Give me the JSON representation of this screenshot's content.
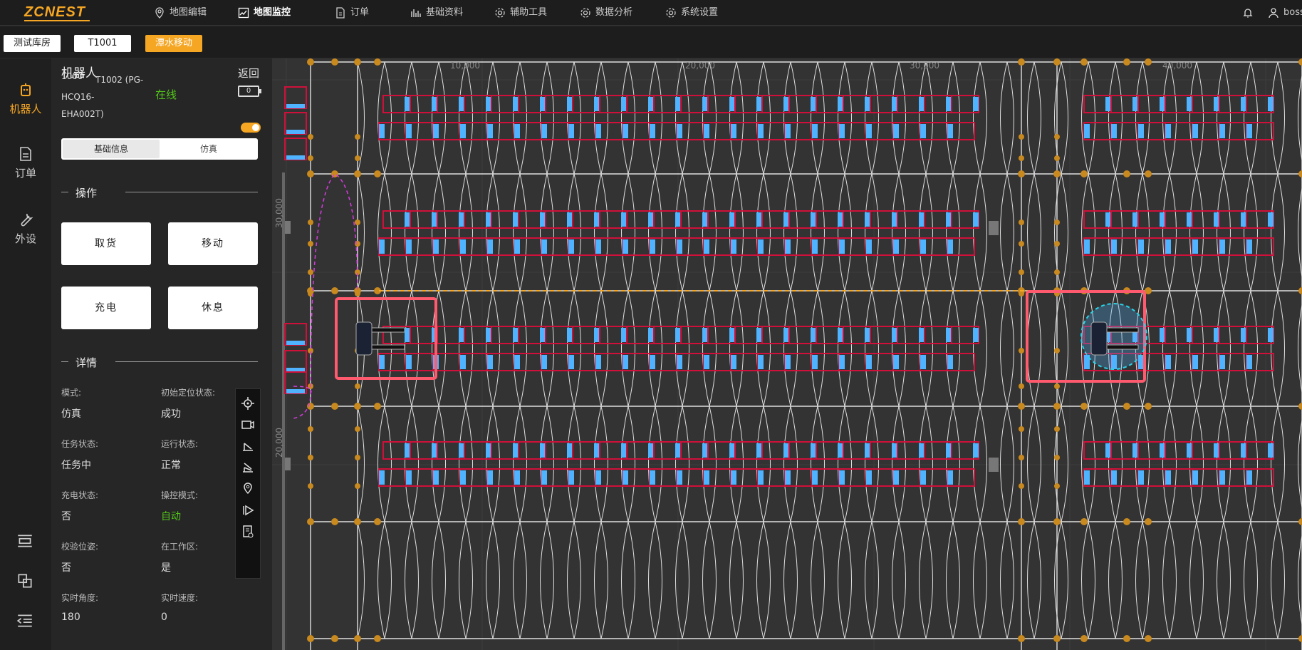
{
  "header": {
    "logo": "ZCNEST",
    "nav": [
      {
        "label": "地图编辑",
        "icon": "map-pin-icon"
      },
      {
        "label": "地图监控",
        "icon": "chart-line-icon",
        "active": true
      },
      {
        "label": "订单",
        "icon": "document-icon"
      },
      {
        "label": "基础资料",
        "icon": "database-icon"
      },
      {
        "label": "辅助工具",
        "icon": "gear-icon"
      },
      {
        "label": "数据分析",
        "icon": "gear-icon"
      },
      {
        "label": "系统设置",
        "icon": "gear-icon"
      }
    ],
    "user": "boss"
  },
  "toolbar": {
    "warehouse": "测试库房",
    "robot_id": "T1001",
    "mode": "潭水移动"
  },
  "leftnav": [
    {
      "label": "机器人",
      "icon": "robot-icon",
      "active": true
    },
    {
      "label": "订单",
      "icon": "document-icon"
    },
    {
      "label": "外设",
      "icon": "wrench-icon"
    }
  ],
  "panel": {
    "title": "机器人",
    "back": "返回",
    "robot_name_lines": [
      "T1002 (PG-",
      "HCQ16-",
      "EHA002T)"
    ],
    "robot_name_prefix": "1000",
    "status": "在线",
    "battery": "0",
    "tabs": [
      "基础信息",
      "仿真"
    ],
    "section_ops": "操作",
    "buttons": [
      "取货",
      "移动",
      "充电",
      "休息"
    ],
    "section_details": "详情",
    "details": [
      {
        "label": "模式:",
        "value": "仿真"
      },
      {
        "label": "初始定位状态:",
        "value": "成功"
      },
      {
        "label": "任务状态:",
        "value": "任务中"
      },
      {
        "label": "运行状态:",
        "value": "正常"
      },
      {
        "label": "充电状态:",
        "value": "否"
      },
      {
        "label": "操控模式:",
        "value": "自动",
        "color": "#52c41a"
      },
      {
        "label": "校验位姿:",
        "value": "否"
      },
      {
        "label": "在工作区:",
        "value": "是"
      },
      {
        "label": "实时角度:",
        "value": "180"
      },
      {
        "label": "实时速度:",
        "value": "0"
      }
    ]
  },
  "map": {
    "axis_top": [
      "10,000",
      "20,000",
      "30,000",
      "40,000"
    ],
    "axis_left": [
      "30,000",
      "20,000"
    ],
    "colors": {
      "background": "#333333",
      "shelf": "#d0103a",
      "slot": "#4fb3ff",
      "path": "#e0e0e0",
      "node": "#c8891e",
      "highlight": "#ff5a6e",
      "route": "#f5a623"
    }
  },
  "side_tools": [
    "locate-icon",
    "camera-icon",
    "forklift-up-icon",
    "forklift-down-icon",
    "pin-icon",
    "play-icon",
    "report-icon"
  ]
}
